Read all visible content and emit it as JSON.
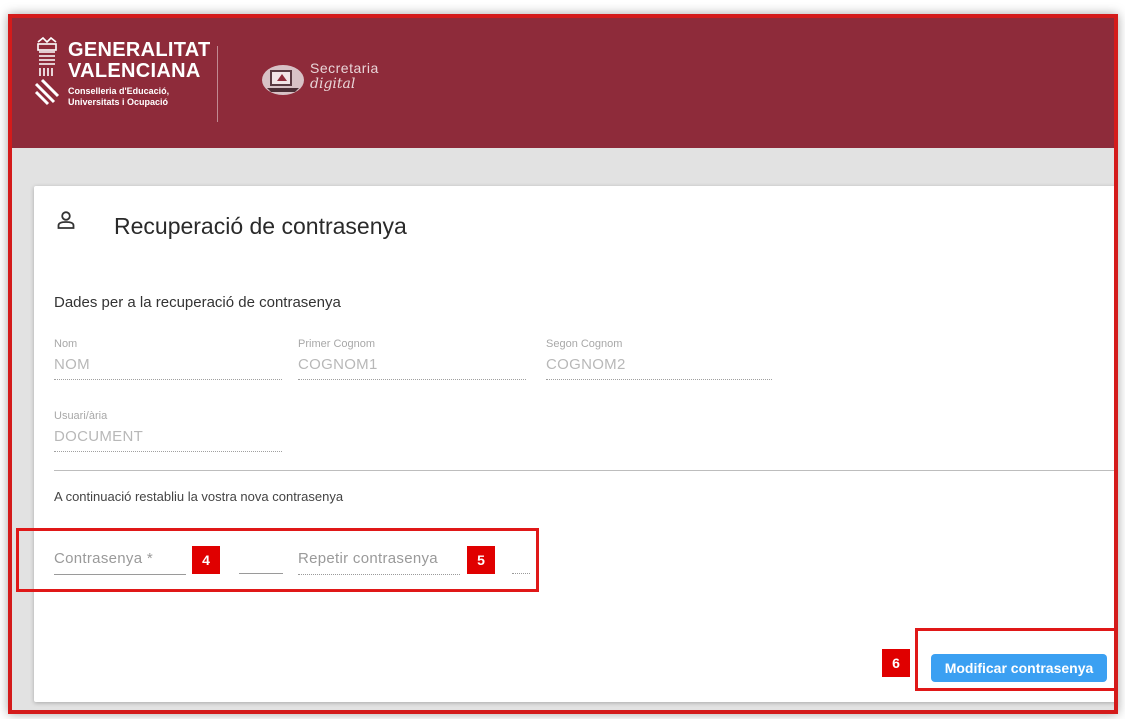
{
  "header": {
    "org_line1": "GENERALITAT",
    "org_line2": "VALENCIANA",
    "org_sub1": "Conselleria d'Educació,",
    "org_sub2": "Universitats i Ocupació",
    "app_line1": "Secretaria",
    "app_line2": "digital",
    "brand_color": "#8e2b3a"
  },
  "card": {
    "title": "Recuperació de contrasenya",
    "icon": "user-icon",
    "section_title": "Dades per a la recuperació de contrasenya",
    "fields": {
      "nom": {
        "label": "Nom",
        "value": "NOM"
      },
      "primer_cognom": {
        "label": "Primer Cognom",
        "value": "COGNOM1"
      },
      "segon_cognom": {
        "label": "Segon Cognom",
        "value": "COGNOM2"
      },
      "usuari": {
        "label": "Usuari/ària",
        "value": "DOCUMENT"
      }
    },
    "instruction": "A continuació restabliu la vostra nova contrasenya",
    "password": {
      "placeholder": "Contrasenya *"
    },
    "password_repeat": {
      "placeholder": "Repetir contrasenya"
    },
    "submit_label": "Modificar contrasenya",
    "button_color": "#3ba0f2"
  },
  "annotations": {
    "badge_password": "4",
    "badge_repeat": "5",
    "badge_submit": "6",
    "highlight_color": "#e01818"
  }
}
